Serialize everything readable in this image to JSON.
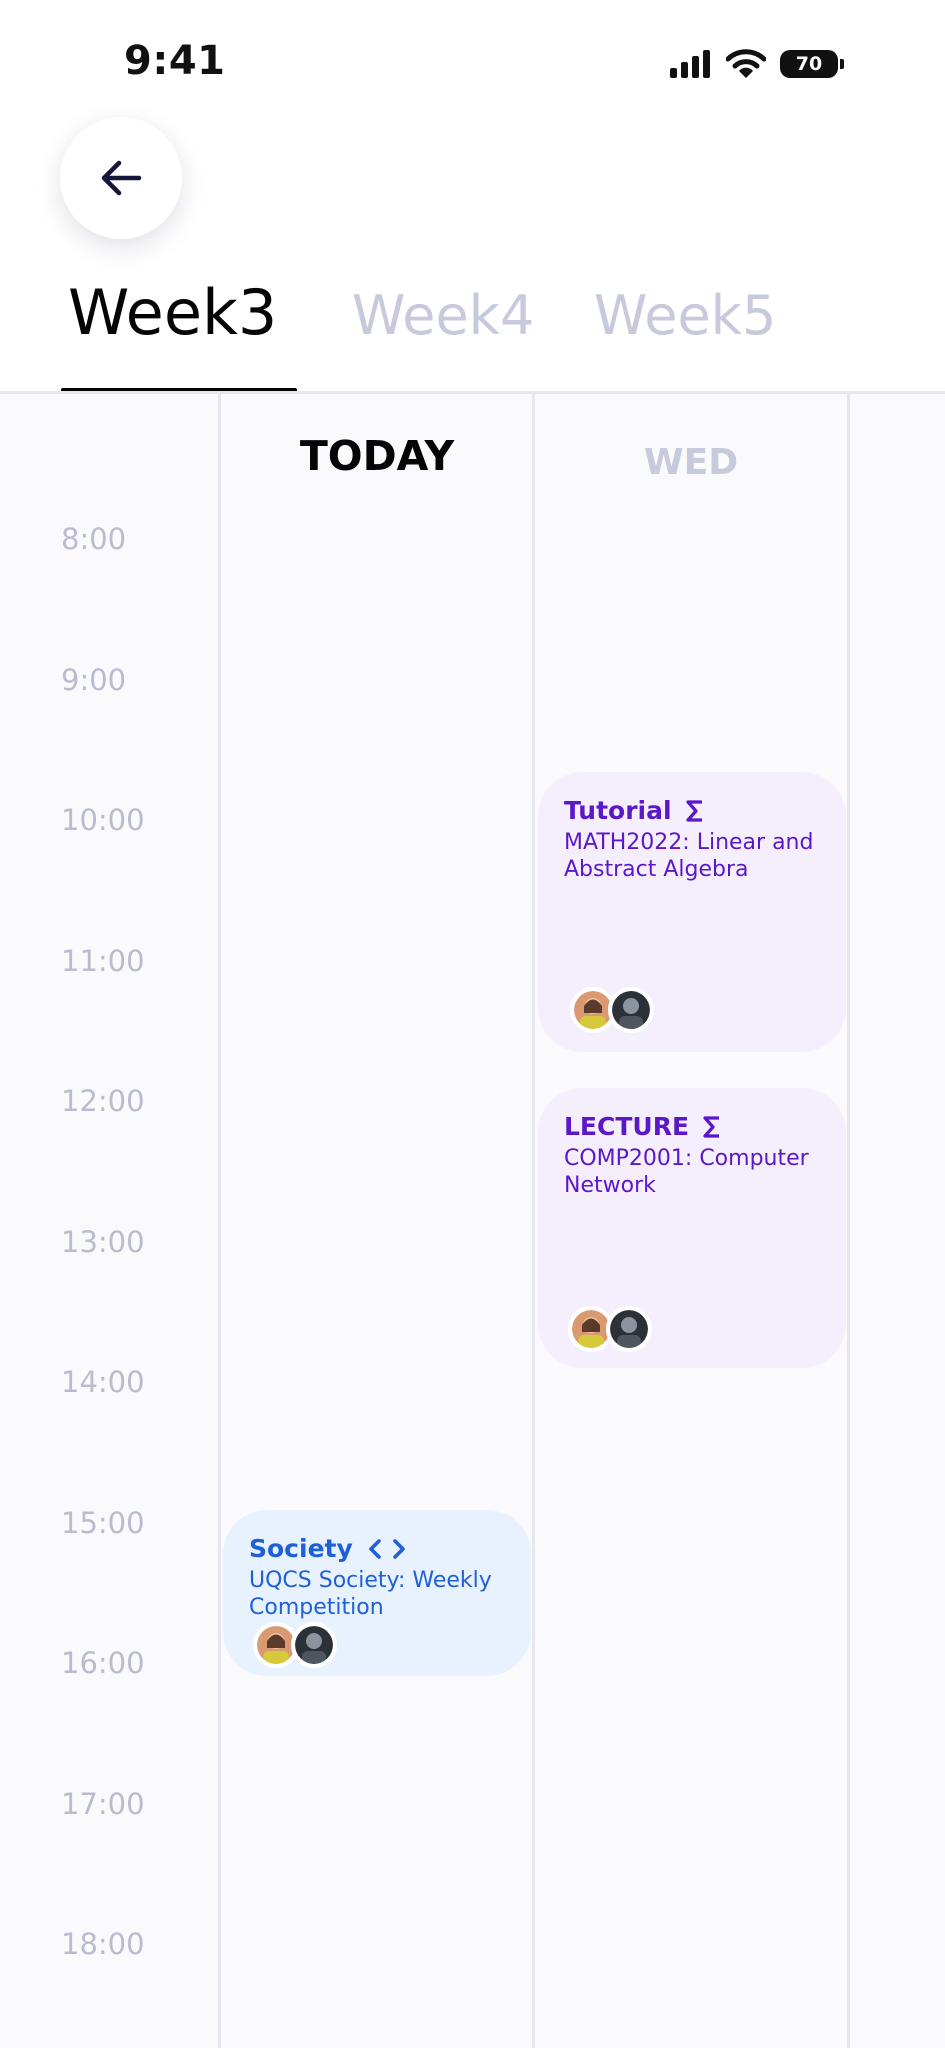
{
  "status": {
    "time": "9:41",
    "battery": "70"
  },
  "tabs": [
    {
      "label": "Week3",
      "active": true
    },
    {
      "label": "Week4",
      "active": false
    },
    {
      "label": "Week5",
      "active": false
    }
  ],
  "days": [
    {
      "label": "TODAY",
      "active": true
    },
    {
      "label": "WED",
      "active": false
    }
  ],
  "hours": [
    "8:00",
    "9:00",
    "10:00",
    "11:00",
    "12:00",
    "13:00",
    "14:00",
    "15:00",
    "16:00",
    "17:00",
    "18:00"
  ],
  "events": [
    {
      "type": "Tutorial",
      "icon": "sigma-icon",
      "title": "MATH2022: Linear and Abstract Algebra",
      "day": "WED",
      "start": "10:00",
      "end": "12:00"
    },
    {
      "type": "LECTURE",
      "icon": "sigma-icon",
      "title": "COMP2001:  Computer Network",
      "day": "WED",
      "start": "12:00",
      "end": "14:00"
    },
    {
      "type": "Society",
      "icon": "code-icon",
      "title": "UQCS Society: Weekly Competition",
      "day": "TODAY",
      "start": "15:00",
      "end": "16:00"
    }
  ],
  "colors": {
    "purple_text": "#5a18c8",
    "purple_bg": "#f5effd",
    "blue_text": "#1f5fd8",
    "blue_bg": "#e8f1fe",
    "inactive": "#c7c9dc",
    "hour_label": "#b9bccf"
  }
}
